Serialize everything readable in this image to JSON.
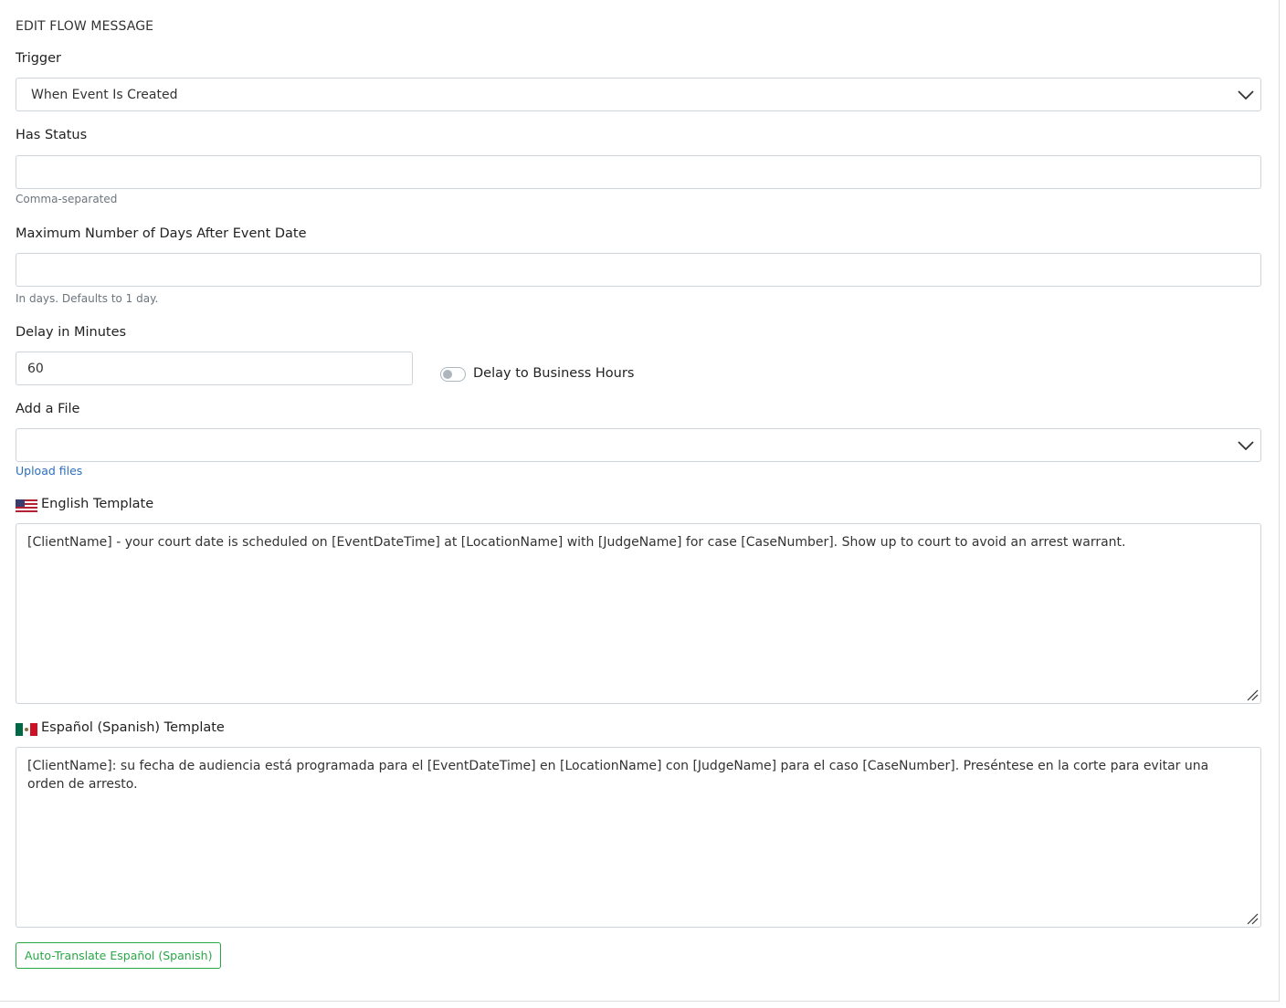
{
  "form": {
    "title": "EDIT FLOW MESSAGE",
    "trigger": {
      "label": "Trigger",
      "value": "When Event Is Created"
    },
    "has_status": {
      "label": "Has Status",
      "value": "",
      "help": "Comma-separated"
    },
    "max_days": {
      "label": "Maximum Number of Days After Event Date",
      "value": "",
      "help": "In days. Defaults to 1 day."
    },
    "delay": {
      "label": "Delay in Minutes",
      "value": "60",
      "toggle_label": "Delay to Business Hours",
      "toggle_on": false
    },
    "file": {
      "label": "Add a File",
      "value": "",
      "upload_link": "Upload files"
    },
    "english": {
      "label": "English Template",
      "flag": "us-flag-icon",
      "text": "[ClientName] - your court date is scheduled on [EventDateTime] at [LocationName] with [JudgeName] for case [CaseNumber]. Show up to court to avoid an arrest warrant."
    },
    "spanish": {
      "label": "Español (Spanish) Template",
      "flag": "mx-flag-icon",
      "text": "[ClientName]: su fecha de audiencia está programada para el [EventDateTime] en [LocationName] con [JudgeName] para el caso [CaseNumber]. Preséntese en la corte para evitar una orden de arresto."
    },
    "translate_button": "Auto-Translate Español (Spanish)"
  },
  "colors": {
    "accent_green": "#28a745",
    "link_blue": "#2a6ebd",
    "border": "#ced4da"
  }
}
